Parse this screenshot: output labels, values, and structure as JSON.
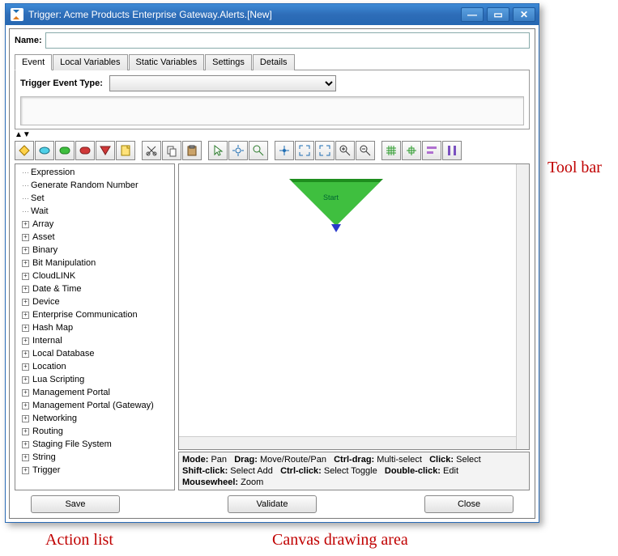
{
  "window": {
    "title": "Trigger:  Acme Products Enterprise Gateway.Alerts.[New]"
  },
  "name": {
    "label": "Name:",
    "value": ""
  },
  "tabs": [
    "Event",
    "Local Variables",
    "Static Variables",
    "Settings",
    "Details"
  ],
  "event": {
    "trigger_label": "Trigger Event Type:"
  },
  "toolbar": {
    "shapes": [
      "diamond",
      "ellipse",
      "roundrect",
      "roundrect-red",
      "triangle",
      "page"
    ],
    "edit": [
      "cut",
      "copy",
      "paste"
    ],
    "tools": [
      "pointer",
      "pan-hand",
      "zoom-glass",
      "center",
      "fit",
      "fit-sel",
      "zoom-in",
      "zoom-out",
      "grid-toggle",
      "snap",
      "align-left",
      "align-dist"
    ]
  },
  "tree": {
    "leaves": [
      "Expression",
      "Generate Random Number",
      "Set",
      "Wait"
    ],
    "folders": [
      "Array",
      "Asset",
      "Binary",
      "Bit Manipulation",
      "CloudLINK",
      "Date & Time",
      "Device",
      "Enterprise Communication",
      "Hash Map",
      "Internal",
      "Local Database",
      "Location",
      "Lua Scripting",
      "Management Portal",
      "Management Portal (Gateway)",
      "Networking",
      "Routing",
      "Staging File System",
      "String",
      "Trigger"
    ]
  },
  "canvas": {
    "start_label": "Start"
  },
  "status": {
    "mode_l": "Mode:",
    "mode_v": "Pan",
    "drag_l": "Drag:",
    "drag_v": "Move/Route/Pan",
    "cdrag_l": "Ctrl-drag:",
    "cdrag_v": "Multi-select",
    "click_l": "Click:",
    "click_v": "Select",
    "sclick_l": "Shift-click:",
    "sclick_v": "Select Add",
    "cclick_l": "Ctrl-click:",
    "cclick_v": "Select Toggle",
    "dclick_l": "Double-click:",
    "dclick_v": "Edit",
    "wheel_l": "Mousewheel:",
    "wheel_v": "Zoom"
  },
  "buttons": {
    "save": "Save",
    "validate": "Validate",
    "close": "Close"
  },
  "annotations": {
    "toolbar": "Tool bar",
    "actions": "Action list",
    "canvas": "Canvas drawing area"
  }
}
